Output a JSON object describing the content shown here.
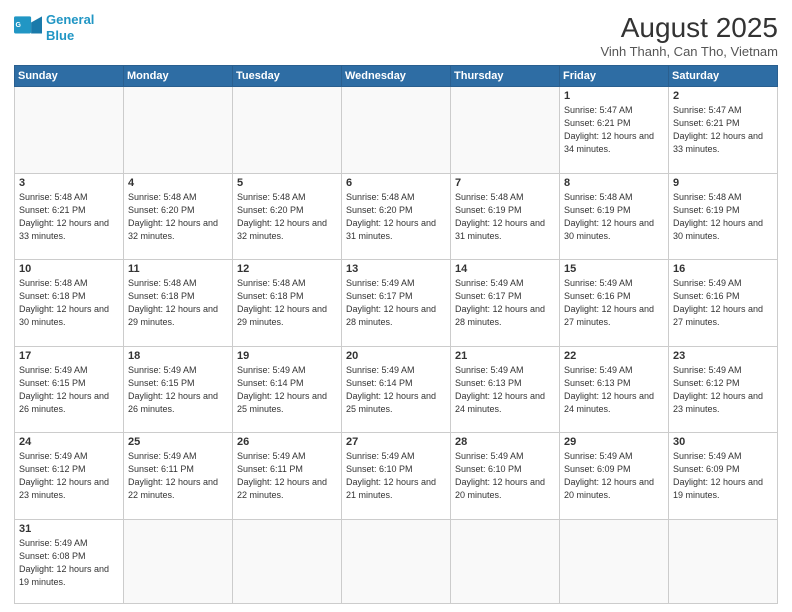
{
  "header": {
    "logo_line1": "General",
    "logo_line2": "Blue",
    "title": "August 2025",
    "subtitle": "Vinh Thanh, Can Tho, Vietnam"
  },
  "days_of_week": [
    "Sunday",
    "Monday",
    "Tuesday",
    "Wednesday",
    "Thursday",
    "Friday",
    "Saturday"
  ],
  "weeks": [
    [
      {
        "day": "",
        "info": ""
      },
      {
        "day": "",
        "info": ""
      },
      {
        "day": "",
        "info": ""
      },
      {
        "day": "",
        "info": ""
      },
      {
        "day": "",
        "info": ""
      },
      {
        "day": "1",
        "info": "Sunrise: 5:47 AM\nSunset: 6:21 PM\nDaylight: 12 hours\nand 34 minutes."
      },
      {
        "day": "2",
        "info": "Sunrise: 5:47 AM\nSunset: 6:21 PM\nDaylight: 12 hours\nand 33 minutes."
      }
    ],
    [
      {
        "day": "3",
        "info": "Sunrise: 5:48 AM\nSunset: 6:21 PM\nDaylight: 12 hours\nand 33 minutes."
      },
      {
        "day": "4",
        "info": "Sunrise: 5:48 AM\nSunset: 6:20 PM\nDaylight: 12 hours\nand 32 minutes."
      },
      {
        "day": "5",
        "info": "Sunrise: 5:48 AM\nSunset: 6:20 PM\nDaylight: 12 hours\nand 32 minutes."
      },
      {
        "day": "6",
        "info": "Sunrise: 5:48 AM\nSunset: 6:20 PM\nDaylight: 12 hours\nand 31 minutes."
      },
      {
        "day": "7",
        "info": "Sunrise: 5:48 AM\nSunset: 6:19 PM\nDaylight: 12 hours\nand 31 minutes."
      },
      {
        "day": "8",
        "info": "Sunrise: 5:48 AM\nSunset: 6:19 PM\nDaylight: 12 hours\nand 30 minutes."
      },
      {
        "day": "9",
        "info": "Sunrise: 5:48 AM\nSunset: 6:19 PM\nDaylight: 12 hours\nand 30 minutes."
      }
    ],
    [
      {
        "day": "10",
        "info": "Sunrise: 5:48 AM\nSunset: 6:18 PM\nDaylight: 12 hours\nand 30 minutes."
      },
      {
        "day": "11",
        "info": "Sunrise: 5:48 AM\nSunset: 6:18 PM\nDaylight: 12 hours\nand 29 minutes."
      },
      {
        "day": "12",
        "info": "Sunrise: 5:48 AM\nSunset: 6:18 PM\nDaylight: 12 hours\nand 29 minutes."
      },
      {
        "day": "13",
        "info": "Sunrise: 5:49 AM\nSunset: 6:17 PM\nDaylight: 12 hours\nand 28 minutes."
      },
      {
        "day": "14",
        "info": "Sunrise: 5:49 AM\nSunset: 6:17 PM\nDaylight: 12 hours\nand 28 minutes."
      },
      {
        "day": "15",
        "info": "Sunrise: 5:49 AM\nSunset: 6:16 PM\nDaylight: 12 hours\nand 27 minutes."
      },
      {
        "day": "16",
        "info": "Sunrise: 5:49 AM\nSunset: 6:16 PM\nDaylight: 12 hours\nand 27 minutes."
      }
    ],
    [
      {
        "day": "17",
        "info": "Sunrise: 5:49 AM\nSunset: 6:15 PM\nDaylight: 12 hours\nand 26 minutes."
      },
      {
        "day": "18",
        "info": "Sunrise: 5:49 AM\nSunset: 6:15 PM\nDaylight: 12 hours\nand 26 minutes."
      },
      {
        "day": "19",
        "info": "Sunrise: 5:49 AM\nSunset: 6:14 PM\nDaylight: 12 hours\nand 25 minutes."
      },
      {
        "day": "20",
        "info": "Sunrise: 5:49 AM\nSunset: 6:14 PM\nDaylight: 12 hours\nand 25 minutes."
      },
      {
        "day": "21",
        "info": "Sunrise: 5:49 AM\nSunset: 6:13 PM\nDaylight: 12 hours\nand 24 minutes."
      },
      {
        "day": "22",
        "info": "Sunrise: 5:49 AM\nSunset: 6:13 PM\nDaylight: 12 hours\nand 24 minutes."
      },
      {
        "day": "23",
        "info": "Sunrise: 5:49 AM\nSunset: 6:12 PM\nDaylight: 12 hours\nand 23 minutes."
      }
    ],
    [
      {
        "day": "24",
        "info": "Sunrise: 5:49 AM\nSunset: 6:12 PM\nDaylight: 12 hours\nand 23 minutes."
      },
      {
        "day": "25",
        "info": "Sunrise: 5:49 AM\nSunset: 6:11 PM\nDaylight: 12 hours\nand 22 minutes."
      },
      {
        "day": "26",
        "info": "Sunrise: 5:49 AM\nSunset: 6:11 PM\nDaylight: 12 hours\nand 22 minutes."
      },
      {
        "day": "27",
        "info": "Sunrise: 5:49 AM\nSunset: 6:10 PM\nDaylight: 12 hours\nand 21 minutes."
      },
      {
        "day": "28",
        "info": "Sunrise: 5:49 AM\nSunset: 6:10 PM\nDaylight: 12 hours\nand 20 minutes."
      },
      {
        "day": "29",
        "info": "Sunrise: 5:49 AM\nSunset: 6:09 PM\nDaylight: 12 hours\nand 20 minutes."
      },
      {
        "day": "30",
        "info": "Sunrise: 5:49 AM\nSunset: 6:09 PM\nDaylight: 12 hours\nand 19 minutes."
      }
    ],
    [
      {
        "day": "31",
        "info": "Sunrise: 5:49 AM\nSunset: 6:08 PM\nDaylight: 12 hours\nand 19 minutes."
      },
      {
        "day": "",
        "info": ""
      },
      {
        "day": "",
        "info": ""
      },
      {
        "day": "",
        "info": ""
      },
      {
        "day": "",
        "info": ""
      },
      {
        "day": "",
        "info": ""
      },
      {
        "day": "",
        "info": ""
      }
    ]
  ]
}
